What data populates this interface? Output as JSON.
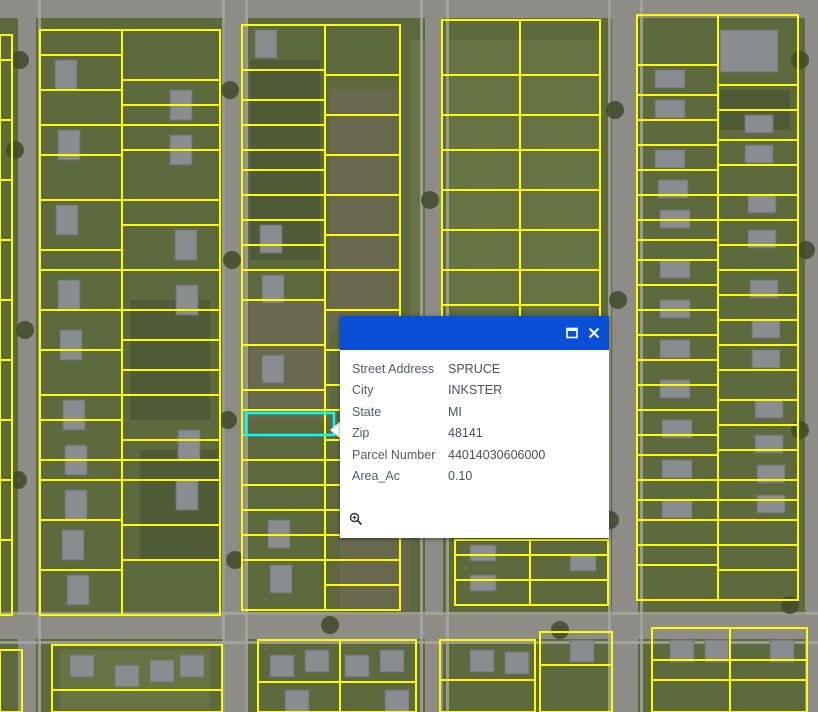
{
  "map": {
    "imagery_colors": {
      "grass": "#5d6a3e",
      "grass_dark": "#4c5735",
      "grass_light": "#6e7746",
      "dirt": "#6f6a55",
      "road": "#8d8c86",
      "sidewalk": "#a9a8a0",
      "roof": "#8a8d90"
    },
    "parcel_outline_color": "#ffff00",
    "selection_color": "#00ffff"
  },
  "popup": {
    "header_color": "#0a50d6",
    "maximize_icon": "maximize-icon",
    "close_icon": "close-icon",
    "zoom_icon": "zoom-to-icon",
    "fields": [
      {
        "label": "Street Address",
        "value": "SPRUCE"
      },
      {
        "label": "City",
        "value": "INKSTER"
      },
      {
        "label": "State",
        "value": "MI"
      },
      {
        "label": "Zip",
        "value": "48141"
      },
      {
        "label": "Parcel Number",
        "value": "44014030606000"
      },
      {
        "label": "Area_Ac",
        "value": "0.10"
      }
    ]
  }
}
